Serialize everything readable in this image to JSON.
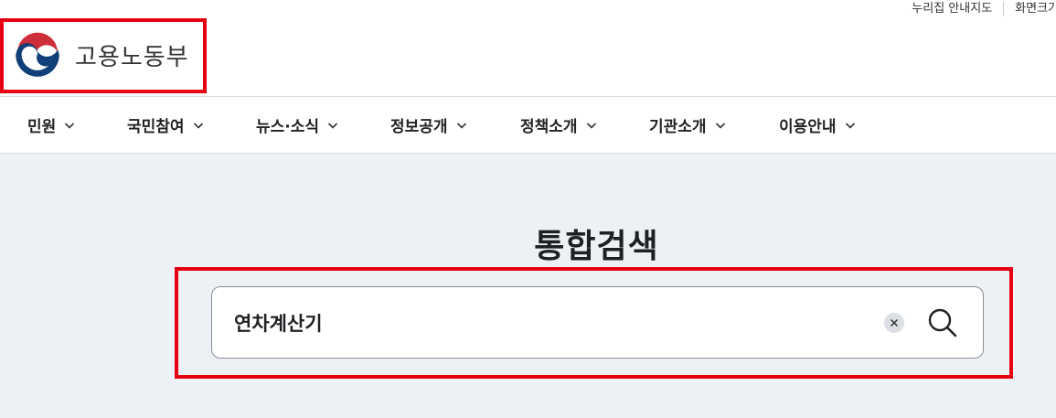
{
  "utility": {
    "links": [
      {
        "label": "누리집 안내지도"
      },
      {
        "label": "화면크기"
      }
    ]
  },
  "logo": {
    "text": "고용노동부"
  },
  "gnb": {
    "items": [
      {
        "label": "민원"
      },
      {
        "label": "국민참여"
      },
      {
        "label": "뉴스·소식"
      },
      {
        "label": "정보공개"
      },
      {
        "label": "정책소개"
      },
      {
        "label": "기관소개"
      },
      {
        "label": "이용안내"
      }
    ]
  },
  "search": {
    "title": "통합검색",
    "value": "연차계산기"
  },
  "colors": {
    "highlight": "#e60012",
    "search_bg": "#edf0f4",
    "logo_red": "#cd2e3a",
    "logo_blue": "#0f3e78"
  }
}
